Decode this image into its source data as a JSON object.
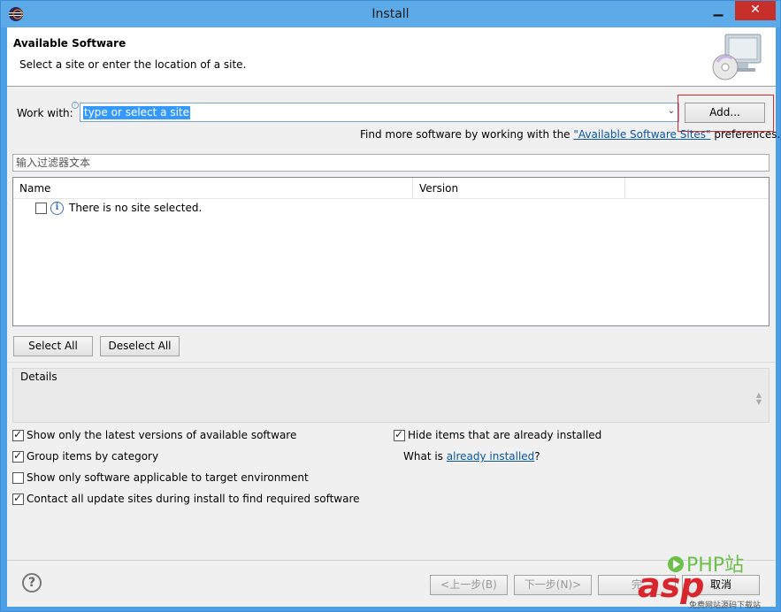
{
  "window": {
    "title": "Install"
  },
  "header": {
    "title": "Available Software",
    "subtitle": "Select a site or enter the location of a site."
  },
  "work_with": {
    "label": "Work with:",
    "value": "type or select a site",
    "add_label": "Add..."
  },
  "find_more": {
    "prefix": "Find more software by working with the ",
    "link": "\"Available Software Sites\"",
    "suffix": " preferences."
  },
  "filter": {
    "placeholder": "输入过滤器文本"
  },
  "table": {
    "columns": [
      "Name",
      "Version"
    ],
    "empty_message": "There is no site selected."
  },
  "selection_buttons": {
    "select_all": "Select All",
    "deselect_all": "Deselect All"
  },
  "details": {
    "label": "Details"
  },
  "options": {
    "latest_versions": {
      "label": "Show only the latest versions of available software",
      "checked": true
    },
    "group_by_category": {
      "label": "Group items by category",
      "checked": true
    },
    "applicable_only": {
      "label": "Show only software applicable to target environment",
      "checked": false
    },
    "contact_update_sites": {
      "label": "Contact all update sites during install to find required software",
      "checked": true
    },
    "hide_installed": {
      "label": "Hide items that are already installed",
      "checked": true
    },
    "what_is": {
      "prefix": "What is ",
      "link": "already installed",
      "suffix": "?"
    }
  },
  "footer": {
    "back": "<上一步(B)",
    "next": "下一步(N)>",
    "finish": "完",
    "cancel": "取消"
  },
  "watermark": {
    "text1": "PHP站",
    "text2": "asp",
    "text3": "免费网站源码下载站"
  },
  "colors": {
    "titlebar": "#5daae8",
    "close": "#c7302a",
    "link": "#0b56a8",
    "selection": "#3399ff",
    "highlight_box": "#e02a2a"
  }
}
